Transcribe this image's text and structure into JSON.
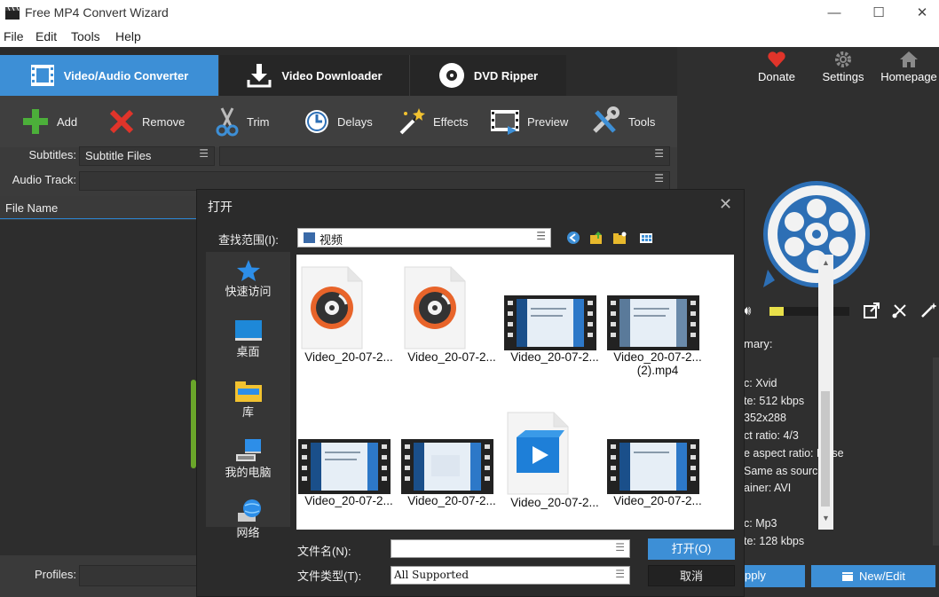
{
  "window": {
    "title": "Free MP4 Convert Wizard",
    "min": "—",
    "max": "☐",
    "close": "✕"
  },
  "menu": [
    "File",
    "Edit",
    "Tools",
    "Help"
  ],
  "tabs": [
    {
      "label": "Video/Audio Converter",
      "icon": "film-icon",
      "active": true
    },
    {
      "label": "Video Downloader",
      "icon": "download-icon",
      "active": false
    },
    {
      "label": "DVD Ripper",
      "icon": "disc-icon",
      "active": false
    }
  ],
  "top_buttons": [
    {
      "label": "Donate",
      "icon": "heart-icon"
    },
    {
      "label": "Settings",
      "icon": "gear-icon"
    },
    {
      "label": "Homepage",
      "icon": "home-icon"
    }
  ],
  "toolbar": [
    {
      "label": "Add",
      "icon": "plus-icon"
    },
    {
      "label": "Remove",
      "icon": "x-icon"
    },
    {
      "label": "Trim",
      "icon": "scissors-icon"
    },
    {
      "label": "Delays",
      "icon": "clock-icon"
    },
    {
      "label": "Effects",
      "icon": "magic-wand-icon"
    },
    {
      "label": "Preview",
      "icon": "filmstrip-icon"
    },
    {
      "label": "Tools",
      "icon": "tools-icon"
    }
  ],
  "subtitles": {
    "label": "Subtitles:",
    "value": "Subtitle Files"
  },
  "audio_track": {
    "label": "Audio Track:",
    "value": ""
  },
  "file_list": {
    "header": "File Name"
  },
  "profiles": {
    "label": "Profiles:"
  },
  "summary": {
    "title": "mary:",
    "lines": [
      "c: Xvid",
      "te: 512 kbps",
      "352x288",
      "ct ratio: 4/3",
      "e aspect ratio: False",
      "Same as source",
      "ainer: AVI",
      "c: Mp3",
      "te: 128 kbps"
    ]
  },
  "right_buttons": {
    "apply": "pply",
    "new_edit": "New/Edit"
  },
  "colors": {
    "accent": "#3d8fd6",
    "dark_bg": "#3b3b3b",
    "green": "#6aa62a"
  },
  "dialog": {
    "title": "打开",
    "look_in_label": "查找范围(I):",
    "look_in_value": "视频",
    "places": [
      "快速访问",
      "桌面",
      "库",
      "我的电脑",
      "网络"
    ],
    "files": [
      {
        "name": "Video_20-07-2...",
        "type": "music"
      },
      {
        "name": "Video_20-07-2...",
        "type": "music"
      },
      {
        "name": "Video_20-07-2...",
        "type": "video"
      },
      {
        "name": "Video_20-07-2...",
        "name2": "(2).mp4",
        "type": "video"
      },
      {
        "name": "Video_20-07-2...",
        "type": "video"
      },
      {
        "name": "Video_20-07-2...",
        "type": "video"
      },
      {
        "name": "Video_20-07-2...",
        "type": "player"
      },
      {
        "name": "Video_20-07-2...",
        "type": "video"
      }
    ],
    "filename_label": "文件名(N):",
    "filename_value": "",
    "filetype_label": "文件类型(T):",
    "filetype_value": "All Supported",
    "open_button": "打开(O)",
    "cancel_button": "取消"
  }
}
